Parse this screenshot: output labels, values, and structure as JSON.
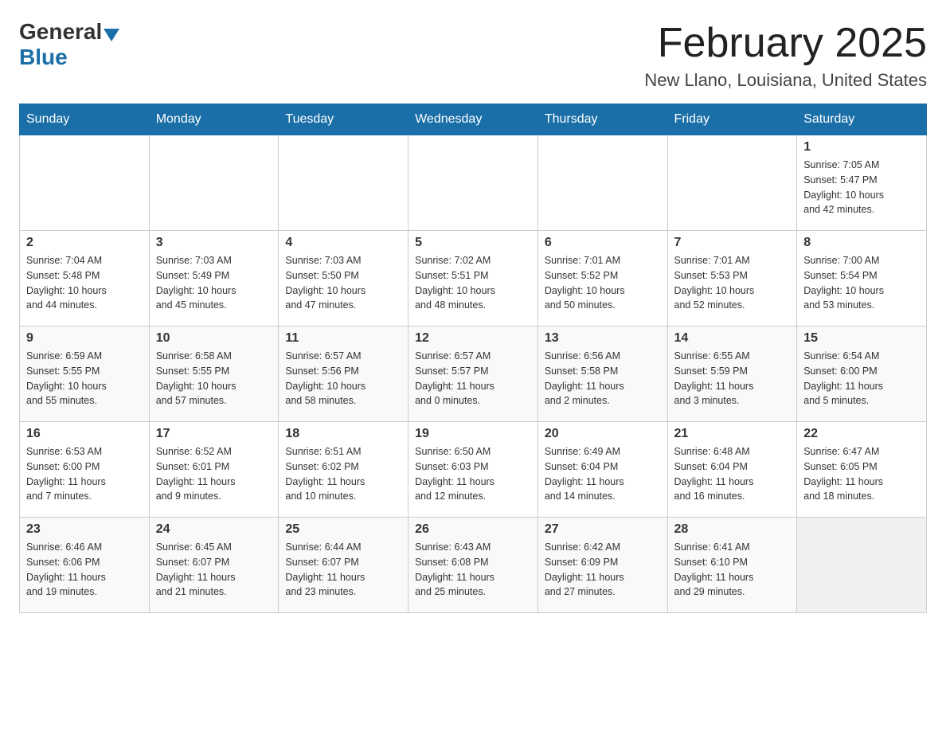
{
  "header": {
    "logo_general": "General",
    "logo_blue": "Blue",
    "title": "February 2025",
    "subtitle": "New Llano, Louisiana, United States"
  },
  "days_of_week": [
    "Sunday",
    "Monday",
    "Tuesday",
    "Wednesday",
    "Thursday",
    "Friday",
    "Saturday"
  ],
  "weeks": [
    [
      {
        "day": "",
        "info": ""
      },
      {
        "day": "",
        "info": ""
      },
      {
        "day": "",
        "info": ""
      },
      {
        "day": "",
        "info": ""
      },
      {
        "day": "",
        "info": ""
      },
      {
        "day": "",
        "info": ""
      },
      {
        "day": "1",
        "info": "Sunrise: 7:05 AM\nSunset: 5:47 PM\nDaylight: 10 hours\nand 42 minutes."
      }
    ],
    [
      {
        "day": "2",
        "info": "Sunrise: 7:04 AM\nSunset: 5:48 PM\nDaylight: 10 hours\nand 44 minutes."
      },
      {
        "day": "3",
        "info": "Sunrise: 7:03 AM\nSunset: 5:49 PM\nDaylight: 10 hours\nand 45 minutes."
      },
      {
        "day": "4",
        "info": "Sunrise: 7:03 AM\nSunset: 5:50 PM\nDaylight: 10 hours\nand 47 minutes."
      },
      {
        "day": "5",
        "info": "Sunrise: 7:02 AM\nSunset: 5:51 PM\nDaylight: 10 hours\nand 48 minutes."
      },
      {
        "day": "6",
        "info": "Sunrise: 7:01 AM\nSunset: 5:52 PM\nDaylight: 10 hours\nand 50 minutes."
      },
      {
        "day": "7",
        "info": "Sunrise: 7:01 AM\nSunset: 5:53 PM\nDaylight: 10 hours\nand 52 minutes."
      },
      {
        "day": "8",
        "info": "Sunrise: 7:00 AM\nSunset: 5:54 PM\nDaylight: 10 hours\nand 53 minutes."
      }
    ],
    [
      {
        "day": "9",
        "info": "Sunrise: 6:59 AM\nSunset: 5:55 PM\nDaylight: 10 hours\nand 55 minutes."
      },
      {
        "day": "10",
        "info": "Sunrise: 6:58 AM\nSunset: 5:55 PM\nDaylight: 10 hours\nand 57 minutes."
      },
      {
        "day": "11",
        "info": "Sunrise: 6:57 AM\nSunset: 5:56 PM\nDaylight: 10 hours\nand 58 minutes."
      },
      {
        "day": "12",
        "info": "Sunrise: 6:57 AM\nSunset: 5:57 PM\nDaylight: 11 hours\nand 0 minutes."
      },
      {
        "day": "13",
        "info": "Sunrise: 6:56 AM\nSunset: 5:58 PM\nDaylight: 11 hours\nand 2 minutes."
      },
      {
        "day": "14",
        "info": "Sunrise: 6:55 AM\nSunset: 5:59 PM\nDaylight: 11 hours\nand 3 minutes."
      },
      {
        "day": "15",
        "info": "Sunrise: 6:54 AM\nSunset: 6:00 PM\nDaylight: 11 hours\nand 5 minutes."
      }
    ],
    [
      {
        "day": "16",
        "info": "Sunrise: 6:53 AM\nSunset: 6:00 PM\nDaylight: 11 hours\nand 7 minutes."
      },
      {
        "day": "17",
        "info": "Sunrise: 6:52 AM\nSunset: 6:01 PM\nDaylight: 11 hours\nand 9 minutes."
      },
      {
        "day": "18",
        "info": "Sunrise: 6:51 AM\nSunset: 6:02 PM\nDaylight: 11 hours\nand 10 minutes."
      },
      {
        "day": "19",
        "info": "Sunrise: 6:50 AM\nSunset: 6:03 PM\nDaylight: 11 hours\nand 12 minutes."
      },
      {
        "day": "20",
        "info": "Sunrise: 6:49 AM\nSunset: 6:04 PM\nDaylight: 11 hours\nand 14 minutes."
      },
      {
        "day": "21",
        "info": "Sunrise: 6:48 AM\nSunset: 6:04 PM\nDaylight: 11 hours\nand 16 minutes."
      },
      {
        "day": "22",
        "info": "Sunrise: 6:47 AM\nSunset: 6:05 PM\nDaylight: 11 hours\nand 18 minutes."
      }
    ],
    [
      {
        "day": "23",
        "info": "Sunrise: 6:46 AM\nSunset: 6:06 PM\nDaylight: 11 hours\nand 19 minutes."
      },
      {
        "day": "24",
        "info": "Sunrise: 6:45 AM\nSunset: 6:07 PM\nDaylight: 11 hours\nand 21 minutes."
      },
      {
        "day": "25",
        "info": "Sunrise: 6:44 AM\nSunset: 6:07 PM\nDaylight: 11 hours\nand 23 minutes."
      },
      {
        "day": "26",
        "info": "Sunrise: 6:43 AM\nSunset: 6:08 PM\nDaylight: 11 hours\nand 25 minutes."
      },
      {
        "day": "27",
        "info": "Sunrise: 6:42 AM\nSunset: 6:09 PM\nDaylight: 11 hours\nand 27 minutes."
      },
      {
        "day": "28",
        "info": "Sunrise: 6:41 AM\nSunset: 6:10 PM\nDaylight: 11 hours\nand 29 minutes."
      },
      {
        "day": "",
        "info": ""
      }
    ]
  ]
}
